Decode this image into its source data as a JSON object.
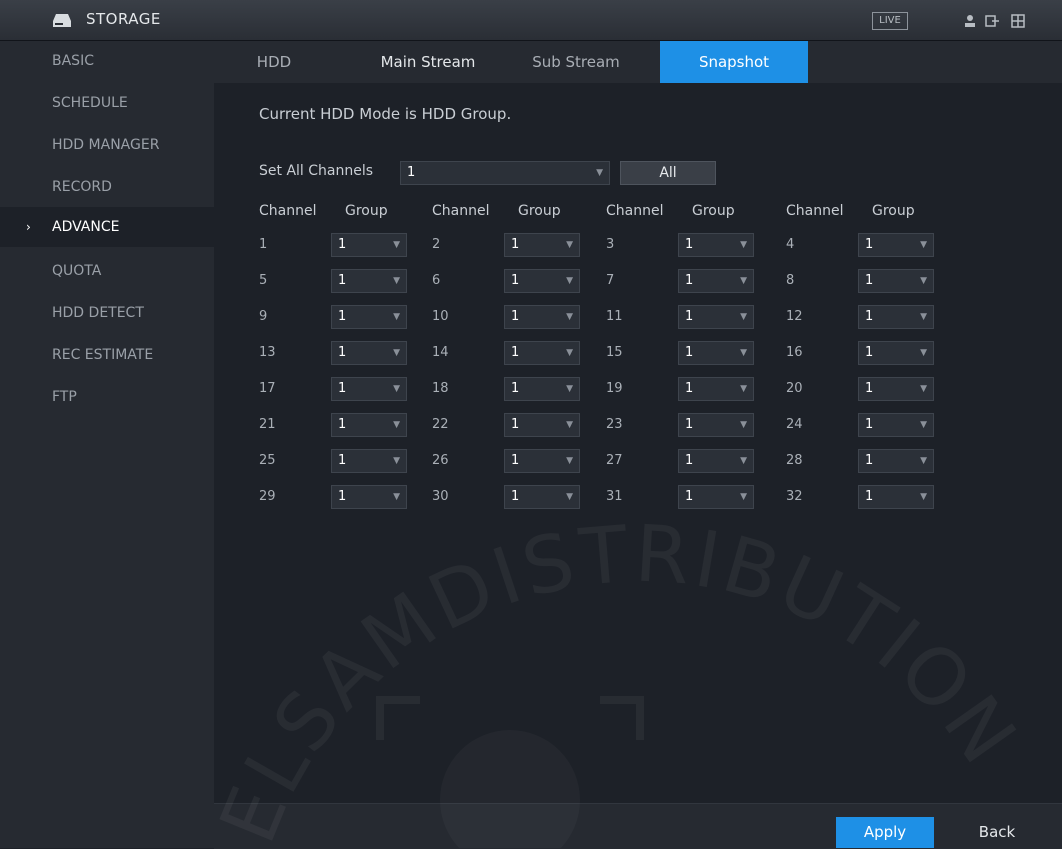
{
  "app": {
    "title": "STORAGE",
    "live_label": "LIVE"
  },
  "sidebar": {
    "items": [
      {
        "label": "BASIC"
      },
      {
        "label": "SCHEDULE"
      },
      {
        "label": "HDD MANAGER"
      },
      {
        "label": "RECORD"
      },
      {
        "label": "ADVANCE",
        "active": true
      },
      {
        "label": "QUOTA"
      },
      {
        "label": "HDD DETECT"
      },
      {
        "label": "REC ESTIMATE"
      },
      {
        "label": "FTP"
      }
    ]
  },
  "tabs": [
    {
      "label": "HDD"
    },
    {
      "label": "Main Stream"
    },
    {
      "label": "Sub Stream"
    },
    {
      "label": "Snapshot",
      "active": true
    }
  ],
  "main": {
    "hdd_mode_text": "Current HDD Mode is HDD Group.",
    "set_all_label": "Set All Channels",
    "set_all_value": "1",
    "all_button": "All",
    "channel_header": "Channel",
    "group_header": "Group",
    "channels": [
      {
        "channel": "1",
        "group": "1"
      },
      {
        "channel": "2",
        "group": "1"
      },
      {
        "channel": "3",
        "group": "1"
      },
      {
        "channel": "4",
        "group": "1"
      },
      {
        "channel": "5",
        "group": "1"
      },
      {
        "channel": "6",
        "group": "1"
      },
      {
        "channel": "7",
        "group": "1"
      },
      {
        "channel": "8",
        "group": "1"
      },
      {
        "channel": "9",
        "group": "1"
      },
      {
        "channel": "10",
        "group": "1"
      },
      {
        "channel": "11",
        "group": "1"
      },
      {
        "channel": "12",
        "group": "1"
      },
      {
        "channel": "13",
        "group": "1"
      },
      {
        "channel": "14",
        "group": "1"
      },
      {
        "channel": "15",
        "group": "1"
      },
      {
        "channel": "16",
        "group": "1"
      },
      {
        "channel": "17",
        "group": "1"
      },
      {
        "channel": "18",
        "group": "1"
      },
      {
        "channel": "19",
        "group": "1"
      },
      {
        "channel": "20",
        "group": "1"
      },
      {
        "channel": "21",
        "group": "1"
      },
      {
        "channel": "22",
        "group": "1"
      },
      {
        "channel": "23",
        "group": "1"
      },
      {
        "channel": "24",
        "group": "1"
      },
      {
        "channel": "25",
        "group": "1"
      },
      {
        "channel": "26",
        "group": "1"
      },
      {
        "channel": "27",
        "group": "1"
      },
      {
        "channel": "28",
        "group": "1"
      },
      {
        "channel": "29",
        "group": "1"
      },
      {
        "channel": "30",
        "group": "1"
      },
      {
        "channel": "31",
        "group": "1"
      },
      {
        "channel": "32",
        "group": "1"
      }
    ]
  },
  "footer": {
    "apply_label": "Apply",
    "back_label": "Back"
  },
  "watermark": {
    "text": "ELSAMDISTRIBUTION"
  },
  "icons": {
    "storage": "hdd-icon",
    "user": "user-icon",
    "logout": "logout-icon",
    "layout": "layout-icon",
    "advance_arrow": "chevron-right-icon",
    "dropdown": "chevron-down-icon"
  },
  "colors": {
    "accent": "#1e90e6",
    "sidebar_bg": "#262a31",
    "main_bg": "#1d2128"
  }
}
